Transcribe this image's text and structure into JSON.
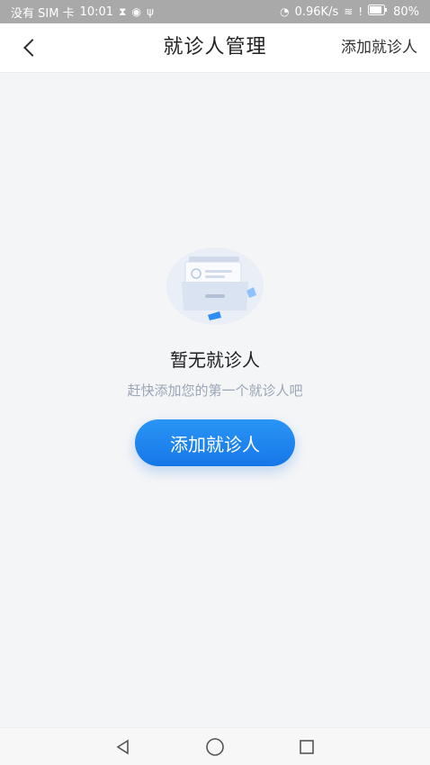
{
  "status_bar": {
    "carrier": "没有 SIM 卡",
    "time": "10:01",
    "net_speed": "0.96K/s",
    "battery": "80%"
  },
  "header": {
    "title": "就诊人管理",
    "add_label": "添加就诊人"
  },
  "empty_state": {
    "title": "暂无就诊人",
    "subtitle": "赶快添加您的第一个就诊人吧",
    "button_label": "添加就诊人"
  },
  "colors": {
    "accent": "#1677e8",
    "subtitle": "#9aa5b7"
  }
}
